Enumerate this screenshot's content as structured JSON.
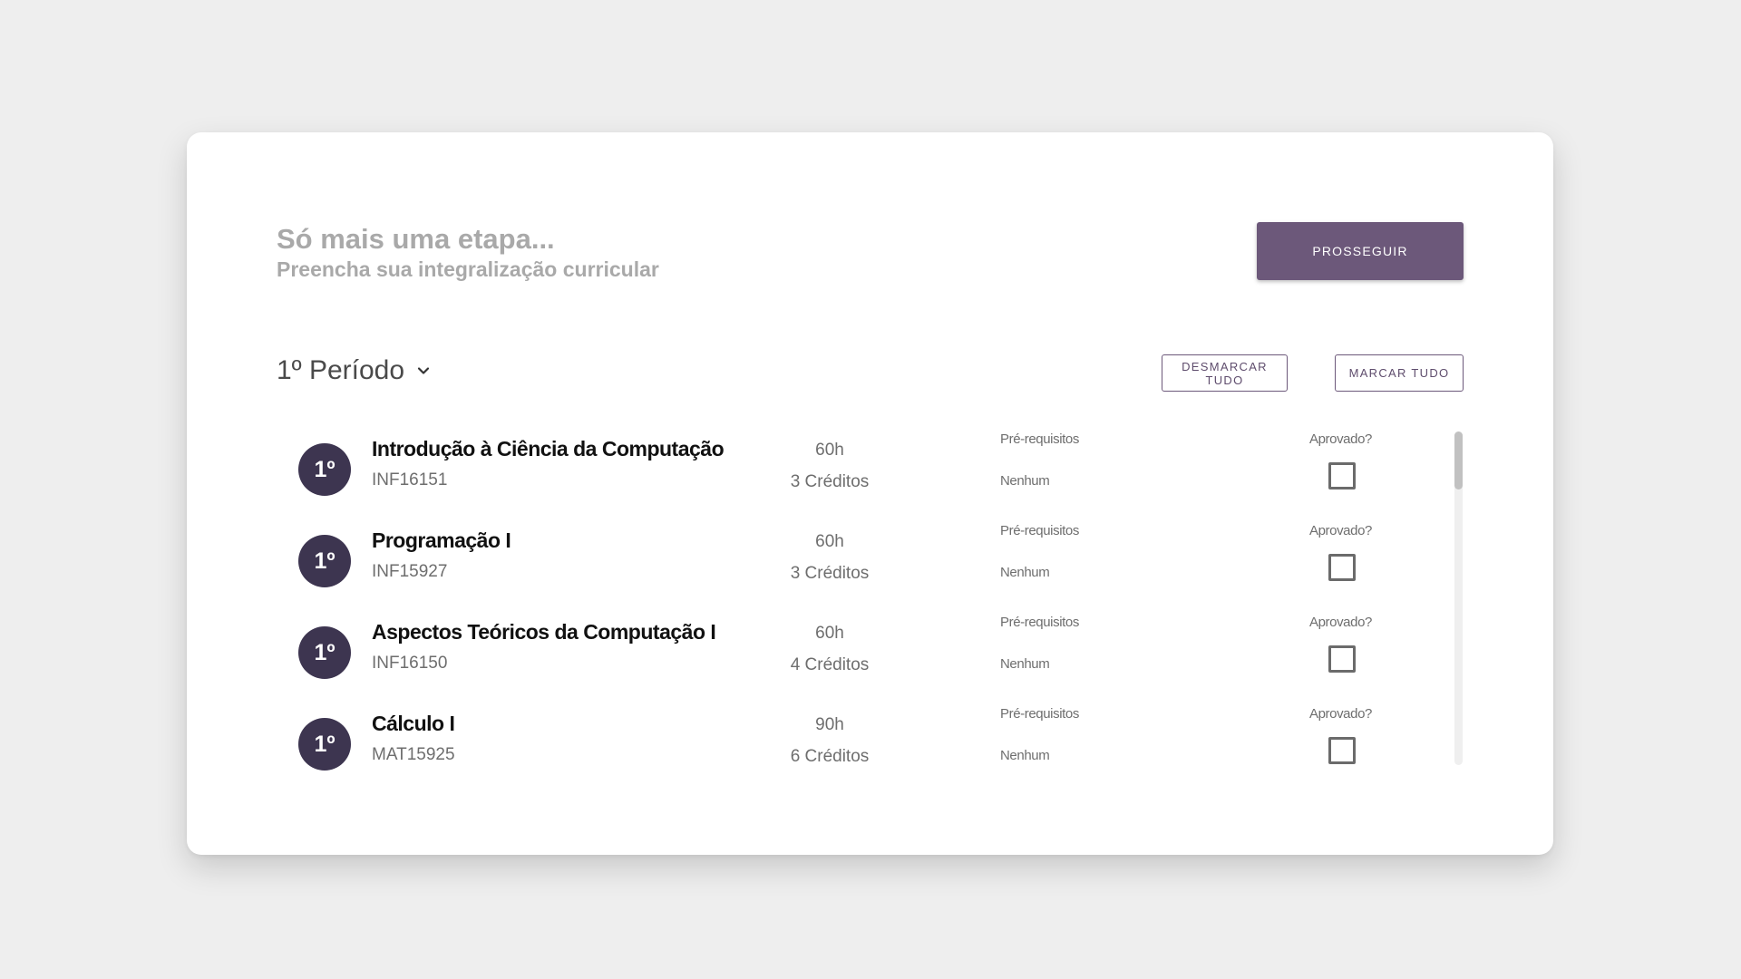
{
  "header": {
    "title": "Só mais uma etapa...",
    "subtitle": "Preencha sua integralização curricular",
    "proceed_label": "PROSSEGUIR"
  },
  "period": {
    "selected": "1º Período",
    "unmark_all_label": "DESMARCAR TUDO",
    "mark_all_label": "MARCAR TUDO"
  },
  "courses": [
    {
      "badge": "1º",
      "name": "Introdução à Ciência da Computação",
      "code": "INF16151",
      "hours": "60h",
      "credits": "3 Créditos",
      "prereq_label": "Pré-requisitos",
      "prereq_value": "Nenhum",
      "approved_label": "Aprovado?",
      "approved": false
    },
    {
      "badge": "1º",
      "name": "Programação I",
      "code": "INF15927",
      "hours": "60h",
      "credits": "3 Créditos",
      "prereq_label": "Pré-requisitos",
      "prereq_value": "Nenhum",
      "approved_label": "Aprovado?",
      "approved": false
    },
    {
      "badge": "1º",
      "name": "Aspectos Teóricos da Computação I",
      "code": "INF16150",
      "hours": "60h",
      "credits": "4 Créditos",
      "prereq_label": "Pré-requisitos",
      "prereq_value": "Nenhum",
      "approved_label": "Aprovado?",
      "approved": false
    },
    {
      "badge": "1º",
      "name": "Cálculo I",
      "code": "MAT15925",
      "hours": "90h",
      "credits": "6 Créditos",
      "prereq_label": "Pré-requisitos",
      "prereq_value": "Nenhum",
      "approved_label": "Aprovado?",
      "approved": false
    }
  ],
  "colors": {
    "background": "#eeeeee",
    "card": "#ffffff",
    "primary": "#6c587a",
    "badge": "#3d3550",
    "muted_heading": "#a9a9a9"
  },
  "icons": {
    "period_dropdown": "chevron-down-icon"
  }
}
